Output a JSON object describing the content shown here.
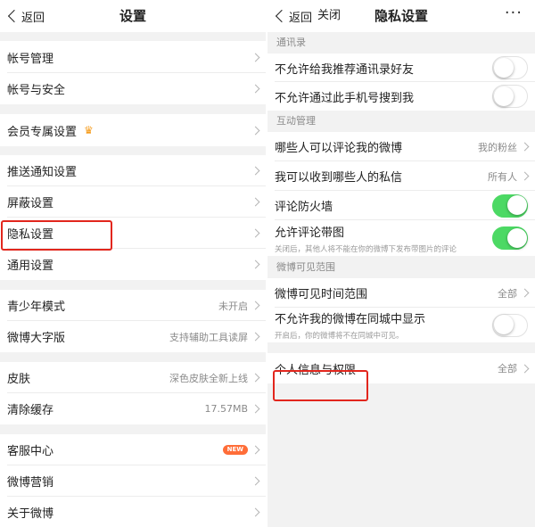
{
  "left": {
    "nav": {
      "back_label": "返回",
      "title": "设置"
    },
    "groups": [
      [
        {
          "label": "帐号管理"
        },
        {
          "label": "帐号与安全"
        }
      ],
      [
        {
          "label": "会员专属设置",
          "icon": "crown-icon"
        }
      ],
      [
        {
          "label": "推送通知设置"
        },
        {
          "label": "屏蔽设置"
        },
        {
          "label": "隐私设置",
          "highlighted": true
        },
        {
          "label": "通用设置"
        }
      ],
      [
        {
          "label": "青少年模式",
          "value": "未开启"
        },
        {
          "label": "微博大字版",
          "value": "支持辅助工具读屏"
        }
      ],
      [
        {
          "label": "皮肤",
          "value": "深色皮肤全新上线"
        },
        {
          "label": "清除缓存",
          "value": "17.57MB"
        }
      ],
      [
        {
          "label": "客服中心",
          "badge": "NEW"
        },
        {
          "label": "微博营销"
        },
        {
          "label": "关于微博"
        }
      ]
    ]
  },
  "right": {
    "nav": {
      "back_label": "返回",
      "close_label": "关闭",
      "title": "隐私设置",
      "more_glyph": "···"
    },
    "sections": [
      {
        "title": "通讯录",
        "rows": [
          {
            "label": "不允许给我推荐通讯录好友",
            "toggle": false
          },
          {
            "label": "不允许通过此手机号搜到我",
            "toggle": false
          }
        ]
      },
      {
        "title": "互动管理",
        "rows": [
          {
            "label": "哪些人可以评论我的微博",
            "value": "我的粉丝"
          },
          {
            "label": "我可以收到哪些人的私信",
            "value": "所有人"
          },
          {
            "label": "评论防火墙",
            "toggle": true
          },
          {
            "label": "允许评论带图",
            "toggle": true,
            "desc": "关闭后，其他人将不能在你的微博下发布带图片的评论"
          }
        ]
      },
      {
        "title": "微博可见范围",
        "rows": [
          {
            "label": "微博可见时间范围",
            "value": "全部"
          },
          {
            "label": "不允许我的微博在同城中显示",
            "toggle": false,
            "desc": "开启后，你的微博将不在同城中可见。"
          }
        ]
      }
    ],
    "personal": {
      "label": "个人信息与权限",
      "value": "全部"
    }
  },
  "colors": {
    "highlight": "#e2261d",
    "toggle_on": "#4cd964",
    "new_badge": "#ff6d38",
    "crown": "#f59b1b"
  }
}
